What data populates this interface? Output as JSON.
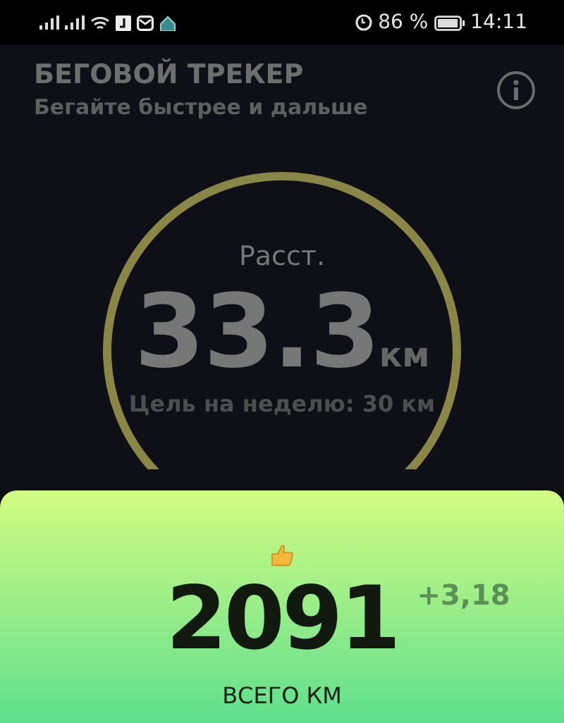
{
  "status_bar": {
    "battery": "86 %",
    "time": "14:11"
  },
  "header": {
    "title": "БЕГОВОЙ ТРЕКЕР",
    "subtitle": "Бегайте быстрее и дальше"
  },
  "distance": {
    "label": "Расст.",
    "value": "33.3",
    "unit": "км",
    "goal": "Цель на неделю: 30 км"
  },
  "total": {
    "value": "2091",
    "delta": "+3,18",
    "label": "ВСЕГО КМ"
  }
}
